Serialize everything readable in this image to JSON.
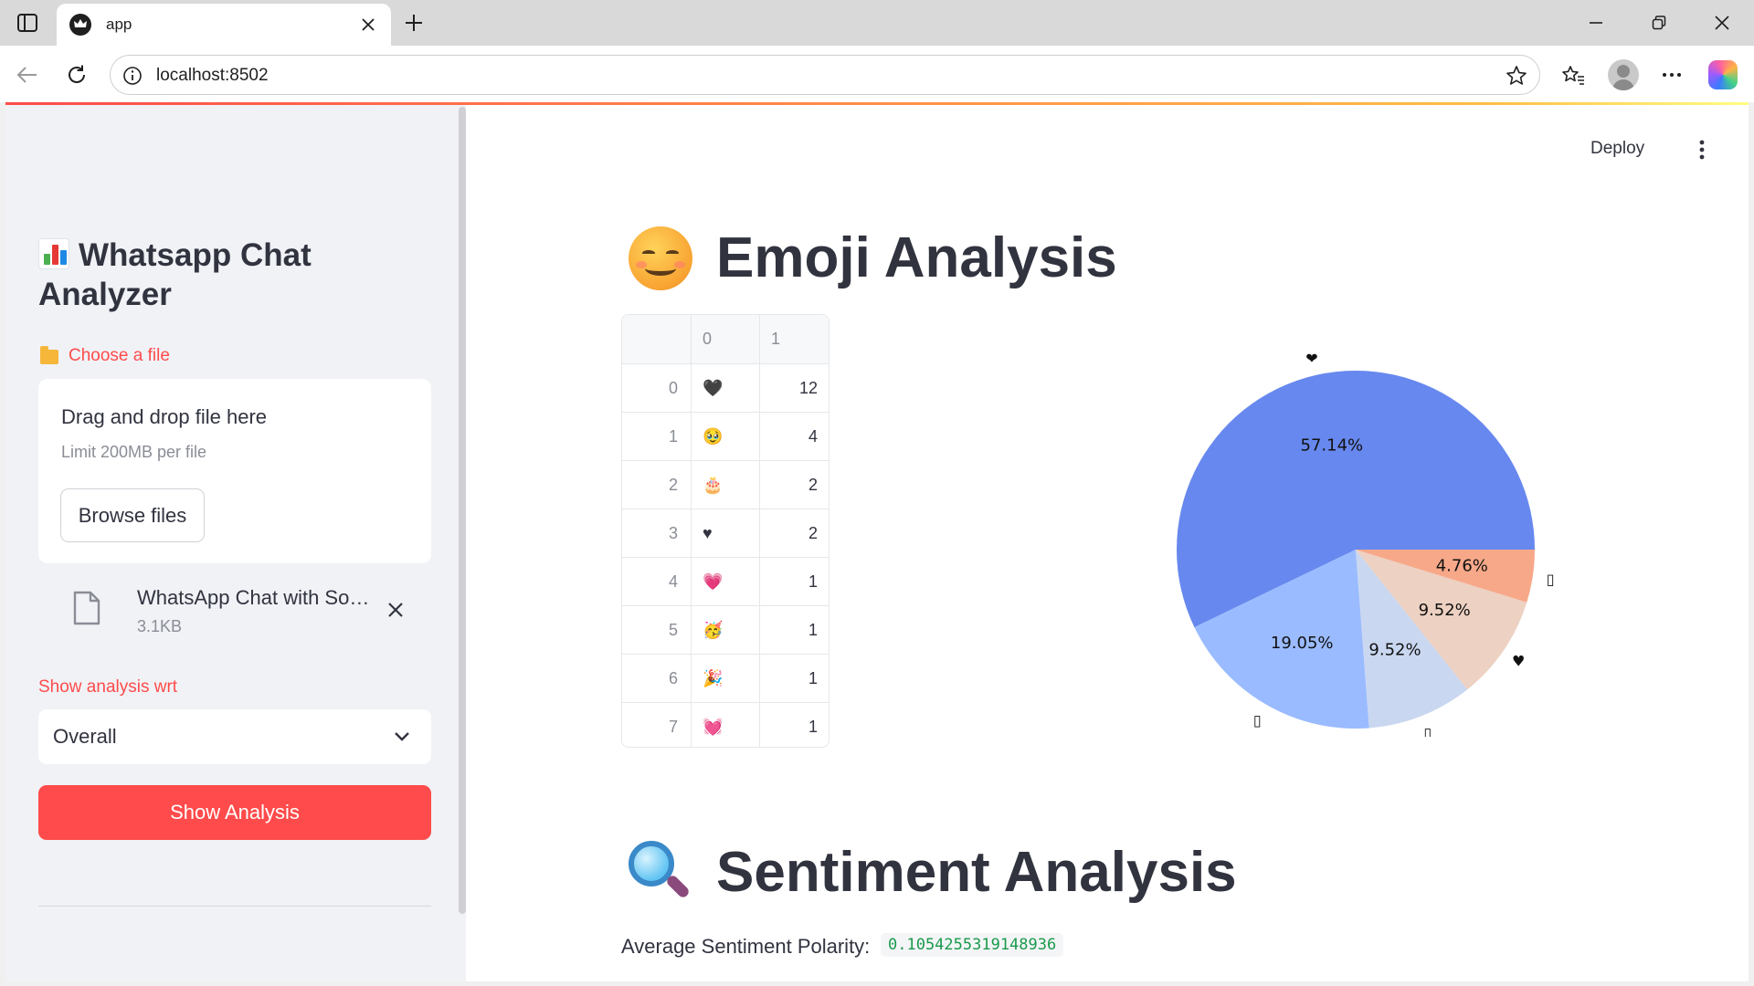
{
  "browser": {
    "tab_title": "app",
    "url": "localhost:8502"
  },
  "app": {
    "deploy_label": "Deploy"
  },
  "sidebar": {
    "title": "Whatsapp Chat Analyzer",
    "title_icon": "bar-chart-emoji",
    "uploader": {
      "label": "Choose a file",
      "drop_text": "Drag and drop file here",
      "limit_text": "Limit 200MB per file",
      "browse_label": "Browse files"
    },
    "file": {
      "name": "WhatsApp Chat with So…",
      "size": "3.1KB"
    },
    "select": {
      "label": "Show analysis wrt",
      "value": "Overall"
    },
    "show_button": "Show Analysis"
  },
  "emoji_section": {
    "title": "Emoji Analysis",
    "title_icon": "smiling-face-emoji",
    "table": {
      "columns": [
        "",
        "0",
        "1"
      ],
      "rows": [
        {
          "index": "0",
          "emoji": "🖤",
          "count": "12"
        },
        {
          "index": "1",
          "emoji": "🥹",
          "count": "4"
        },
        {
          "index": "2",
          "emoji": "🎂",
          "count": "2"
        },
        {
          "index": "3",
          "emoji": "♥",
          "count": "2"
        },
        {
          "index": "4",
          "emoji": "💗",
          "count": "1"
        },
        {
          "index": "5",
          "emoji": "🥳",
          "count": "1"
        },
        {
          "index": "6",
          "emoji": "🎉",
          "count": "1"
        },
        {
          "index": "7",
          "emoji": "💓",
          "count": "1"
        }
      ]
    }
  },
  "chart_data": {
    "type": "pie",
    "labels": [
      "❤",
      "",
      "",
      "♥",
      ""
    ],
    "values": [
      57.14,
      19.05,
      9.52,
      9.52,
      4.76
    ],
    "slice_labels": [
      "57.14%",
      "19.05%",
      "9.52%",
      "9.52%",
      "4.76%"
    ],
    "colors": [
      "#6788ee",
      "#9abbff",
      "#c9d7f0",
      "#edd1c2",
      "#f7a889"
    ],
    "start_angle_deg": 0,
    "direction": "clockwise-on-screen"
  },
  "sentiment_section": {
    "title": "Sentiment Analysis",
    "title_icon": "magnifying-glass-emoji",
    "avg_label": "Average Sentiment Polarity:",
    "avg_value": "0.1054255319148936"
  },
  "colors": {
    "accent": "#ff4b4b",
    "text": "#31333f",
    "sidebar_bg": "#f0f2f6",
    "code_green": "#1a9a4b"
  }
}
